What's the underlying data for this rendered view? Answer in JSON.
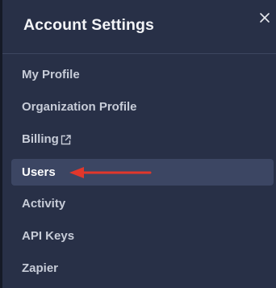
{
  "panel": {
    "title": "Account Settings",
    "close_icon": "close-icon"
  },
  "menu": {
    "items": [
      {
        "label": "My Profile"
      },
      {
        "label": "Organization Profile"
      },
      {
        "label": "Billing",
        "icon": "external-link-icon"
      },
      {
        "label": "Users",
        "selected": true
      },
      {
        "label": "Activity"
      },
      {
        "label": "API Keys"
      },
      {
        "label": "Zapier"
      }
    ]
  },
  "annotation": {
    "arrow_color": "#e2372b",
    "points_to": "Users"
  },
  "colors": {
    "panel_bg": "#283047",
    "selected_bg": "#3c4663",
    "text": "#c7ccd8",
    "title": "#f3f4f7"
  }
}
